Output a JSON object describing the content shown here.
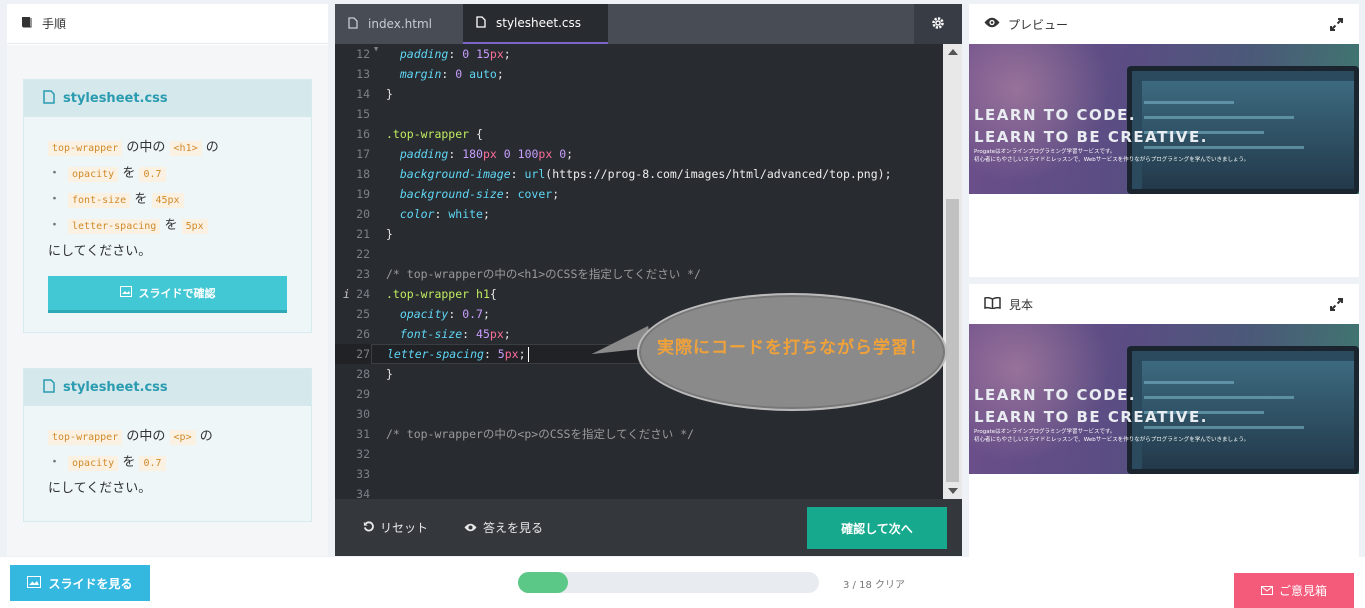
{
  "left_panel": {
    "title": "手順",
    "cards": [
      {
        "file": "stylesheet.css",
        "lines": [
          {
            "code1": "top-wrapper",
            "t1": "の中の",
            "code2": "<h1>",
            "t2": "の"
          },
          {
            "bullet": "・",
            "code1": "opacity",
            "t1": "を",
            "code2": "0.7"
          },
          {
            "bullet": "・",
            "code1": "font-size",
            "t1": "を",
            "code2": "45px"
          },
          {
            "bullet": "・",
            "code1": "letter-spacing",
            "t1": "を",
            "code2": "5px"
          },
          {
            "text": "にしてください。"
          }
        ],
        "button_label": "スライドで確認"
      },
      {
        "file": "stylesheet.css",
        "lines": [
          {
            "code1": "top-wrapper",
            "t1": "の中の",
            "code2": "<p>",
            "t2": "の"
          },
          {
            "bullet": "・",
            "code1": "opacity",
            "t1": "を",
            "code2": "0.7"
          },
          {
            "text": "にしてください。"
          }
        ]
      }
    ]
  },
  "editor": {
    "tabs": [
      {
        "label": "index.html"
      },
      {
        "label": "stylesheet.css"
      }
    ],
    "reset_label": "リセット",
    "answer_label": "答えを見る",
    "next_label": "確認して次へ",
    "bubble_text": "実際にコードを打ちながら学習！",
    "line_numbers": [
      "12",
      "13",
      "14",
      "15",
      "16",
      "17",
      "18",
      "19",
      "20",
      "21",
      "22",
      "23",
      "24",
      "25",
      "26",
      "27",
      "28",
      "29",
      "30",
      "31",
      "32",
      "33",
      "34"
    ]
  },
  "preview": {
    "title": "プレビュー",
    "hero_line1": "LEARN TO CODE.",
    "hero_line2": "LEARN TO BE CREATIVE.",
    "hero_sub1": "Progateはオンラインプログラミング学習サービスです。",
    "hero_sub2": "初心者にもやさしいスライドとレッスンで、Webサービスを作りながらプログラミングを学んでいきましょう。"
  },
  "sample": {
    "title": "見本",
    "hero_line1": "LEARN TO CODE.",
    "hero_line2": "LEARN TO BE CREATIVE.",
    "hero_sub1": "Progateはオンラインプログラミング学習サービスです。",
    "hero_sub2": "初心者にもやさしいスライドとレッスンで、Webサービスを作りながらプログラミングを学んでいきましょう。"
  },
  "footer": {
    "slides_label": "スライドを見る",
    "progress_text": "3 / 18 クリア",
    "progress_fraction": 0.1667,
    "feedback_label": "ご意見箱"
  },
  "colors": {
    "accent": "#42c7d4",
    "next_button": "#17a98e",
    "progress": "#5bc887",
    "feedback": "#f45a7a",
    "slides_button": "#35b8e0"
  }
}
